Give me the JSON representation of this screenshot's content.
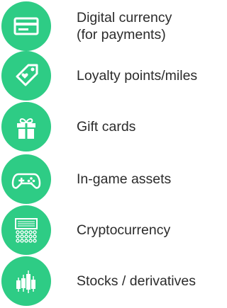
{
  "accent_color": "#2ecc85",
  "items": [
    {
      "icon": "credit-card-icon",
      "lines": [
        "Digital currency",
        "(for payments)"
      ]
    },
    {
      "icon": "price-tag-icon",
      "lines": [
        "Loyalty points/miles"
      ]
    },
    {
      "icon": "gift-box-icon",
      "lines": [
        "Gift cards"
      ]
    },
    {
      "icon": "game-controller-icon",
      "lines": [
        "In-game assets"
      ]
    },
    {
      "icon": "crypto-terminal-icon",
      "lines": [
        "Cryptocurrency"
      ]
    },
    {
      "icon": "candlestick-chart-icon",
      "lines": [
        "Stocks / derivatives"
      ]
    }
  ]
}
